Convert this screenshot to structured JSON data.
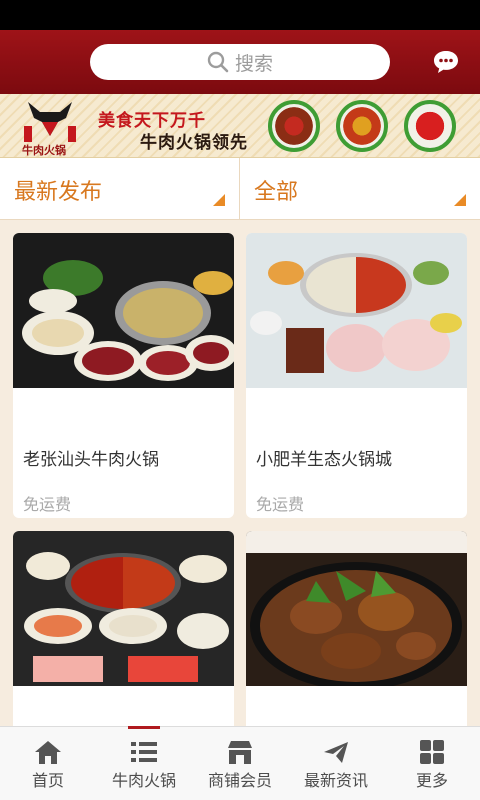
{
  "header": {
    "search_placeholder": "搜索",
    "chat_icon": "chat-bubble-icon"
  },
  "banner": {
    "logo_text": "牛肉火锅",
    "slogan_line1": "美食天下万千",
    "slogan_line2": "牛肉火锅领先"
  },
  "filters": {
    "left_label": "最新发布",
    "right_label": "全部"
  },
  "listings": [
    {
      "name": "老张汕头牛肉火锅",
      "shipping": "免运费"
    },
    {
      "name": "小肥羊生态火锅城",
      "shipping": "免运费"
    },
    {
      "name": "",
      "shipping": ""
    },
    {
      "name": "",
      "shipping": ""
    }
  ],
  "tabbar": {
    "items": [
      {
        "label": "首页",
        "icon": "home-icon"
      },
      {
        "label": "牛肉火锅",
        "icon": "list-icon",
        "active": true
      },
      {
        "label": "商铺会员",
        "icon": "shop-icon"
      },
      {
        "label": "最新资讯",
        "icon": "news-plane-icon"
      },
      {
        "label": "更多",
        "icon": "grid-icon"
      }
    ]
  },
  "colors": {
    "header": "#8e0f14",
    "accent": "#d8781f",
    "background": "#f6ecdf"
  }
}
